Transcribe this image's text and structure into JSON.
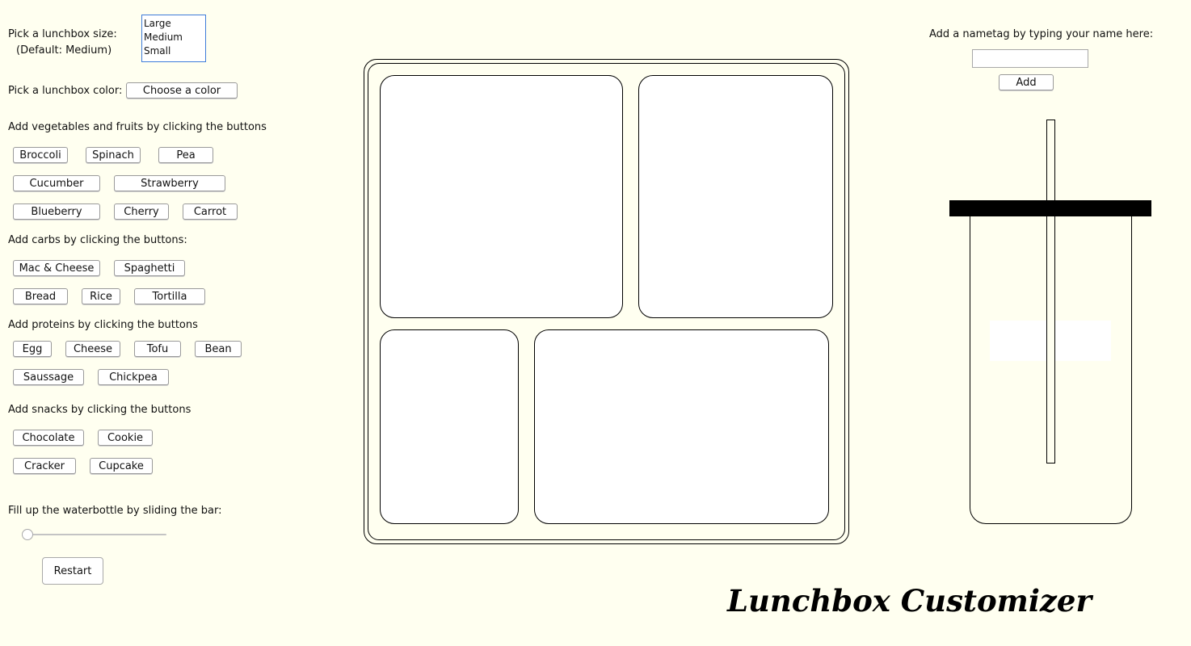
{
  "size": {
    "label": "Pick a lunchbox size:",
    "default_note": "(Default: Medium)",
    "options": [
      "Large",
      "Medium",
      "Small"
    ]
  },
  "color": {
    "label": "Pick a lunchbox color:",
    "button": "Choose a color"
  },
  "vegetables": {
    "label": "Add vegetables and fruits by clicking the buttons",
    "buttons": [
      "Broccoli",
      "Spinach",
      "Pea",
      "Cucumber",
      "Strawberry",
      "Blueberry",
      "Cherry",
      "Carrot"
    ]
  },
  "carbs": {
    "label": "Add carbs by clicking the buttons:",
    "buttons": [
      "Mac & Cheese",
      "Spaghetti",
      "Bread",
      "Rice",
      "Tortilla"
    ]
  },
  "proteins": {
    "label": "Add proteins by clicking the buttons",
    "buttons": [
      "Egg",
      "Cheese",
      "Tofu",
      "Bean",
      "Saussage",
      "Chickpea"
    ]
  },
  "snacks": {
    "label": "Add snacks by clicking the buttons",
    "buttons": [
      "Chocolate",
      "Cookie",
      "Cracker",
      "Cupcake"
    ]
  },
  "water": {
    "label": "Fill up the waterbottle by sliding the bar:",
    "fill_level": 0
  },
  "restart": "Restart",
  "nametag": {
    "label": "Add a nametag by typing your name here:",
    "value": "",
    "button": "Add"
  },
  "title": "Lunchbox Customizer",
  "colors": {
    "background": "#fffff0",
    "lunchbox": "#ffffff",
    "outline": "#000000",
    "listbox_border": "#3d7bd9"
  }
}
